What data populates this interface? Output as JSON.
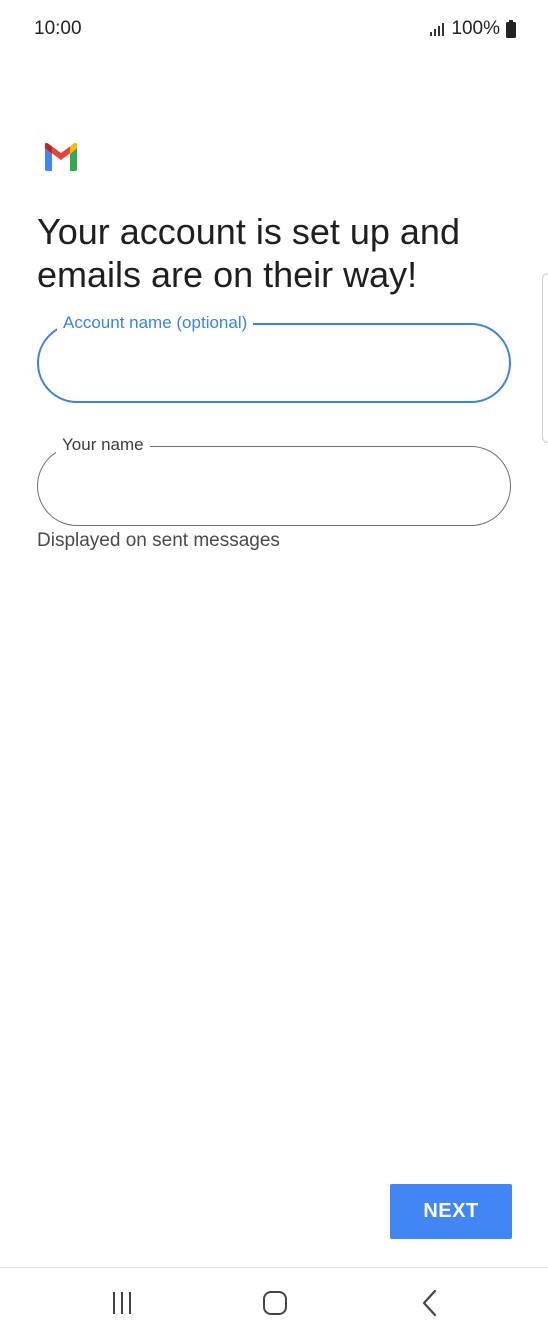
{
  "status_bar": {
    "time": "10:00",
    "battery": "100%",
    "icons": [
      "signal-icon",
      "battery-icon"
    ]
  },
  "brand": {
    "logo": "gmail-logo",
    "colors": {
      "blue": "#4285F4",
      "red": "#EA4335",
      "yellow": "#FBBC04",
      "green": "#34A853"
    }
  },
  "headline": "Your account is set up and emails are on their way!",
  "fields": {
    "account_name": {
      "label": "Account name (optional)",
      "value": "",
      "focused": true
    },
    "your_name": {
      "label": "Your name",
      "value": "",
      "helper": "Displayed on sent messages"
    }
  },
  "actions": {
    "next_label": "NEXT"
  },
  "nav_bar": {
    "icons": [
      "recents-icon",
      "home-icon",
      "back-icon"
    ]
  },
  "colors": {
    "accent": "#3B82E6",
    "button": "#4285F4"
  }
}
